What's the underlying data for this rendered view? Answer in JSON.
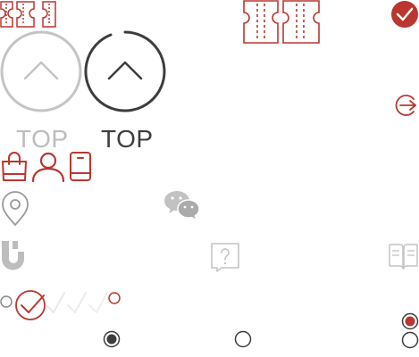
{
  "colors": {
    "brand_red": "#b9372e",
    "light_gray": "#bdbdbd",
    "dark_gray": "#3d3d3d",
    "icon_gray": "#9a9a9a",
    "pale_gray": "#d6d6d6"
  },
  "back_to_top": {
    "light": {
      "label": "TOP",
      "icon": "chevron-up-icon"
    },
    "dark": {
      "label": "TOP",
      "icon": "chevron-up-icon"
    }
  },
  "icons": [
    "ticket-icon",
    "checkmark-circle-icon",
    "arrow-right-circle-icon",
    "shopping-bag-icon",
    "user-icon",
    "mobile-phone-icon",
    "location-pin-icon",
    "wechat-icon",
    "brand-logo-icon",
    "help-question-icon",
    "open-book-icon",
    "radio-button-icon"
  ],
  "radios": {
    "top_right": {
      "state": "selected"
    },
    "bottom_right": {
      "state": "unselected"
    },
    "bottom_left": {
      "state": "selected"
    },
    "bottom_middle": {
      "state": "unselected"
    }
  }
}
